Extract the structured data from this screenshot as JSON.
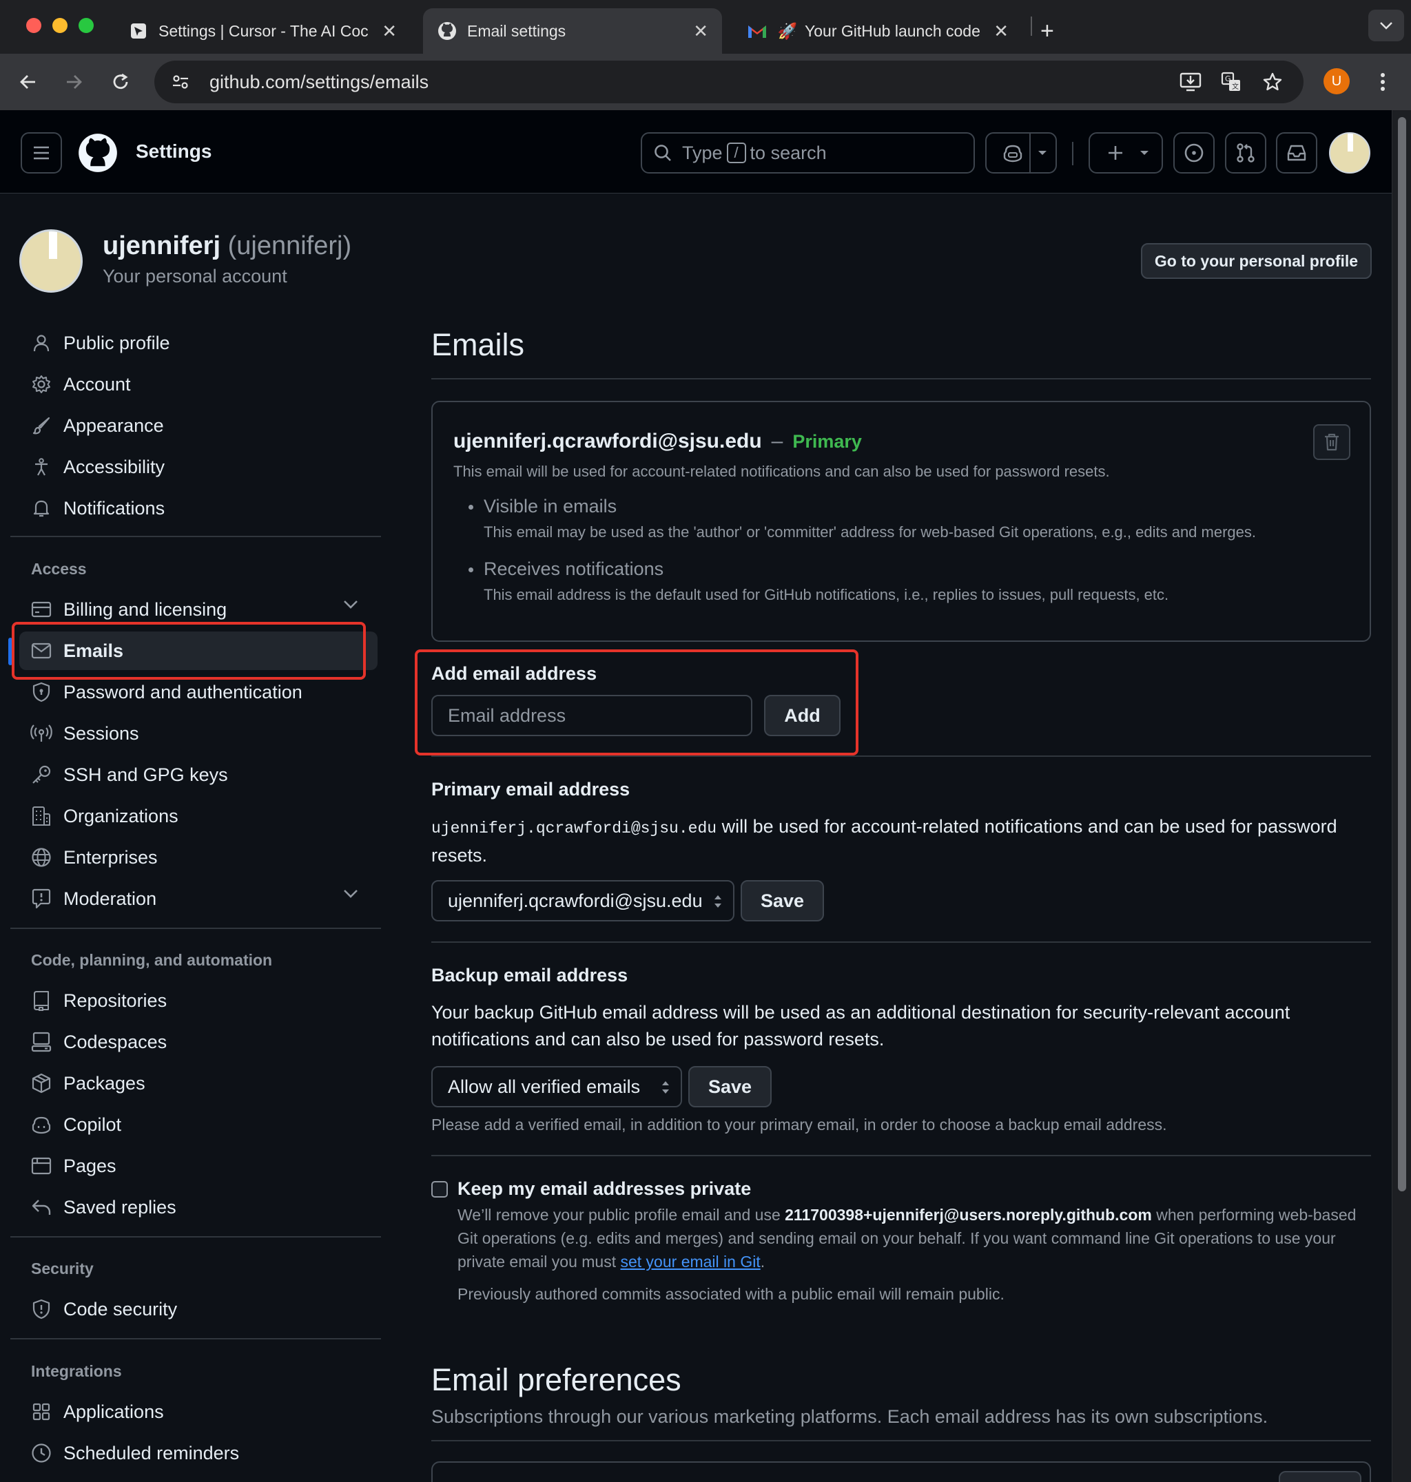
{
  "browser": {
    "tabs": [
      {
        "title": "Settings | Cursor - The AI Coc",
        "icon": "cursor-icon"
      },
      {
        "title": "Email settings",
        "icon": "github-icon"
      },
      {
        "title": "Your GitHub launch code -",
        "icon": "gmail-icon"
      }
    ],
    "url": "github.com/settings/emails",
    "profile_initial": "U"
  },
  "header": {
    "title": "Settings",
    "search_prefix": "Type",
    "search_key": "/",
    "search_suffix": "to search"
  },
  "profile": {
    "name": "ujenniferj",
    "login": "(ujenniferj)",
    "subtitle": "Your personal account",
    "go_profile_label": "Go to your personal profile"
  },
  "sidebar": {
    "items_top": [
      {
        "label": "Public profile",
        "icon": "person-icon"
      },
      {
        "label": "Account",
        "icon": "gear-icon"
      },
      {
        "label": "Appearance",
        "icon": "paintbrush-icon"
      },
      {
        "label": "Accessibility",
        "icon": "accessibility-icon"
      },
      {
        "label": "Notifications",
        "icon": "bell-icon"
      }
    ],
    "group_access": "Access",
    "items_access": [
      {
        "label": "Billing and licensing",
        "icon": "credit-card-icon"
      },
      {
        "label": "Emails",
        "icon": "mail-icon"
      },
      {
        "label": "Password and authentication",
        "icon": "shield-lock-icon"
      },
      {
        "label": "Sessions",
        "icon": "broadcast-icon"
      },
      {
        "label": "SSH and GPG keys",
        "icon": "key-icon"
      },
      {
        "label": "Organizations",
        "icon": "organization-icon"
      },
      {
        "label": "Enterprises",
        "icon": "globe-icon"
      },
      {
        "label": "Moderation",
        "icon": "report-icon"
      }
    ],
    "group_code": "Code, planning, and automation",
    "items_code": [
      {
        "label": "Repositories",
        "icon": "repo-icon"
      },
      {
        "label": "Codespaces",
        "icon": "codespaces-icon"
      },
      {
        "label": "Packages",
        "icon": "package-icon"
      },
      {
        "label": "Copilot",
        "icon": "copilot-icon"
      },
      {
        "label": "Pages",
        "icon": "browser-icon"
      },
      {
        "label": "Saved replies",
        "icon": "reply-icon"
      }
    ],
    "group_security": "Security",
    "items_security": [
      {
        "label": "Code security",
        "icon": "shield-icon"
      }
    ],
    "group_integrations": "Integrations",
    "items_integrations": [
      {
        "label": "Applications",
        "icon": "apps-icon"
      },
      {
        "label": "Scheduled reminders",
        "icon": "clock-icon"
      }
    ]
  },
  "main": {
    "heading": "Emails",
    "primary_email": {
      "address": "ujenniferj.qcrawfordi@sjsu.edu",
      "separator": "–",
      "badge": "Primary",
      "description": "This email will be used for account-related notifications and can also be used for password resets.",
      "bullet1_title": "Visible in emails",
      "bullet1_desc": "This email may be used as the 'author' or 'committer' address for web-based Git operations, e.g., edits and merges.",
      "bullet2_title": "Receives notifications",
      "bullet2_desc": "This email address is the default used for GitHub notifications, i.e., replies to issues, pull requests, etc."
    },
    "add_email": {
      "label": "Add email address",
      "placeholder": "Email address",
      "button": "Add"
    },
    "primary_section": {
      "heading": "Primary email address",
      "mono_email": "ujenniferj.qcrawfordi@sjsu.edu",
      "text": "will be used for account-related notifications and can be used for password resets.",
      "select_value": "ujenniferj.qcrawfordi@sjsu.edu",
      "save": "Save"
    },
    "backup_section": {
      "heading": "Backup email address",
      "text": "Your backup GitHub email address will be used as an additional destination for security-relevant account notifications and can also be used for password resets.",
      "select_value": "Allow all verified emails",
      "save": "Save",
      "note": "Please add a verified email, in addition to your primary email, in order to choose a backup email address."
    },
    "private_section": {
      "label": "Keep my email addresses private",
      "text_a": "We’ll remove your public profile email and use",
      "noreply": "211700398+ujenniferj@users.noreply.github.com",
      "text_b": "when performing web-based Git operations (e.g. edits and merges) and sending email on your behalf. If you want command line Git operations to use your private email you must",
      "link": "set your email in Git",
      "text_c": ".",
      "note": "Previously authored commits associated with a public email will remain public."
    },
    "preferences": {
      "heading": "Email preferences",
      "text": "Subscriptions through our various marketing platforms. Each email address has its own subscriptions."
    }
  }
}
